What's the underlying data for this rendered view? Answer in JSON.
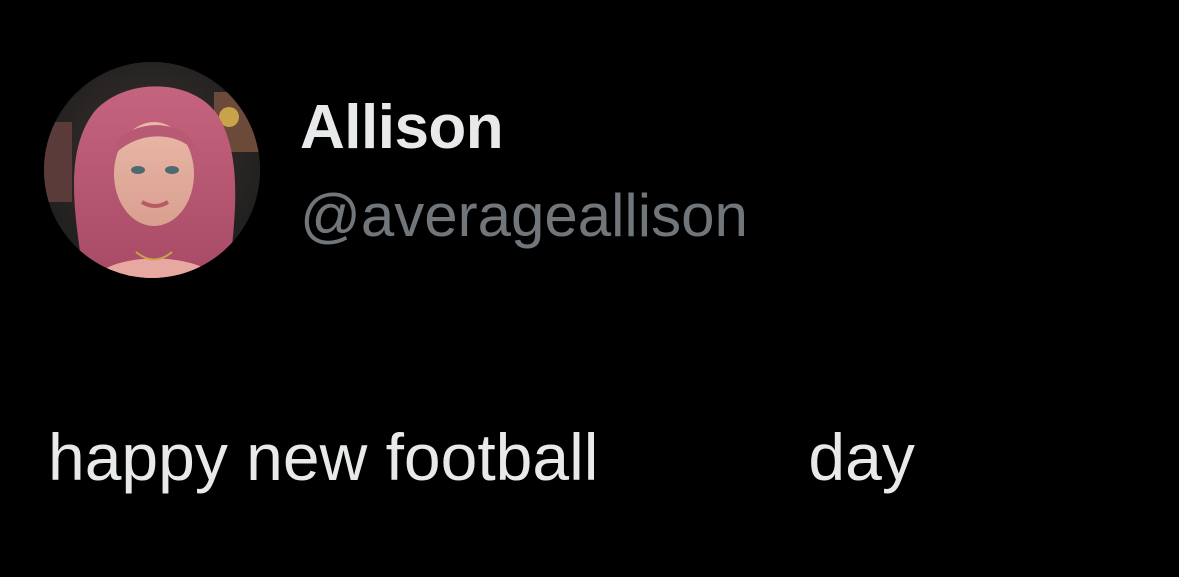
{
  "tweet": {
    "author": {
      "display_name": "Allison",
      "handle": "@averageallison",
      "avatar_icon": "profile-photo"
    },
    "text_part1": "happy new football",
    "text_part2": "day"
  },
  "colors": {
    "background": "#000000",
    "primary_text": "#e7e9ea",
    "secondary_text": "#71767b"
  }
}
